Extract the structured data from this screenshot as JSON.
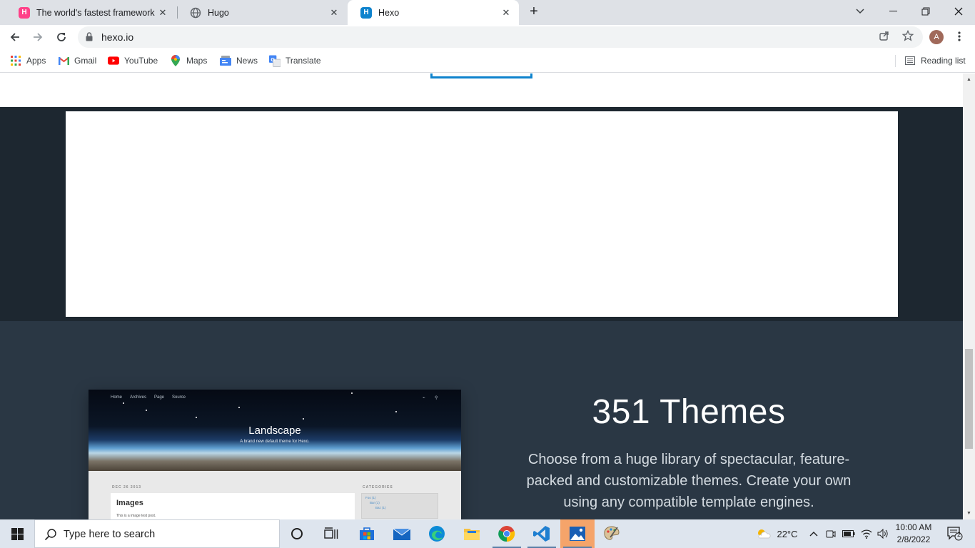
{
  "browser": {
    "tabs": [
      {
        "title": "The world's fastest framework for building websites",
        "favicon": "hugo-pink-icon",
        "active": false
      },
      {
        "title": "Hugo",
        "favicon": "globe-icon",
        "active": false
      },
      {
        "title": "Hexo",
        "favicon": "hexo-icon",
        "active": true
      }
    ],
    "new_tab_symbol": "+",
    "url": "hexo.io",
    "avatar_letter": "A",
    "bookmarks": [
      {
        "label": "Apps",
        "icon": "apps-grid-icon"
      },
      {
        "label": "Gmail",
        "icon": "gmail-icon"
      },
      {
        "label": "YouTube",
        "icon": "youtube-icon"
      },
      {
        "label": "Maps",
        "icon": "maps-icon"
      },
      {
        "label": "News",
        "icon": "news-icon"
      },
      {
        "label": "Translate",
        "icon": "translate-icon"
      }
    ],
    "reading_list_label": "Reading list"
  },
  "page": {
    "theme_preview": {
      "nav_items": [
        "Home",
        "Archives",
        "Page",
        "Source"
      ],
      "hero_title": "Landscape",
      "hero_subtitle": "A brand new default theme for Hexo.",
      "post_date": "DEC 26 2013",
      "post_title": "Images",
      "post_excerpt": "This is a image test post.",
      "categories_heading": "CATEGORIES",
      "categories": [
        "Foo (1)",
        "Bar (1)",
        "Baz (1)"
      ]
    },
    "themes_title": "351 Themes",
    "themes_description": "Choose from a huge library of spectacular, feature-packed and customizable themes. Create your own using any compatible template engines."
  },
  "taskbar": {
    "search_placeholder": "Type here to search",
    "apps": [
      "task-view",
      "widgets",
      "microsoft-store",
      "mail",
      "edge",
      "file-explorer",
      "chrome",
      "vscode",
      "photos",
      "paint"
    ],
    "weather_temp": "22°C",
    "time": "10:00 AM",
    "date": "2/8/2022",
    "notification_count": "2"
  },
  "colors": {
    "dark_band": "#1d2730",
    "themes_bg": "#2a3744",
    "accent": "#0e83cd",
    "tab_strip": "#dee1e6"
  }
}
